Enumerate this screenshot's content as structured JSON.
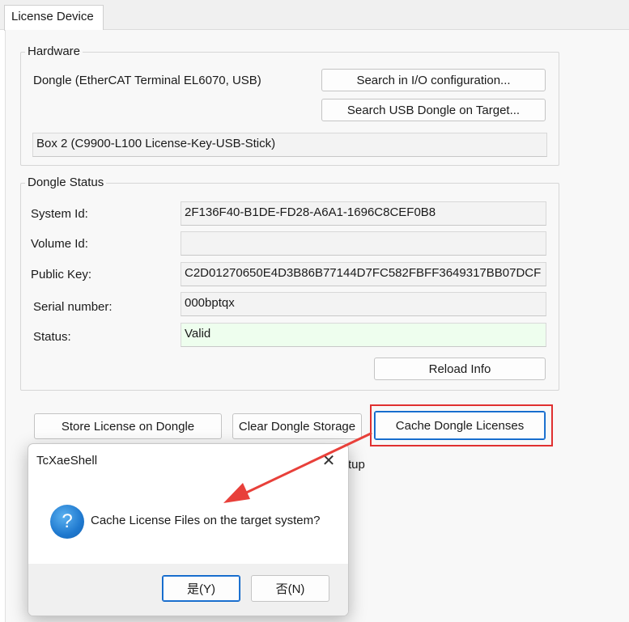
{
  "tab": {
    "label": "License Device"
  },
  "hardware": {
    "legend": "Hardware",
    "dongle_label": "Dongle (EtherCAT Terminal EL6070, USB)",
    "search_io_button": "Search in I/O configuration...",
    "search_usb_button": "Search USB Dongle on Target...",
    "box_value": "Box 2 (C9900-L100 License-Key-USB-Stick)"
  },
  "status": {
    "legend": "Dongle Status",
    "rows": [
      {
        "label": "System Id:",
        "value": "2F136F40-B1DE-FD28-A6A1-1696C8CEF0B8"
      },
      {
        "label": "Volume Id:",
        "value": ""
      },
      {
        "label": "Public Key:",
        "value": "C2D01270650E4D3B86B77144D7FC582FBFF3649317BB07DCF"
      },
      {
        "label": "Serial number:",
        "value": "000bptqx"
      },
      {
        "label": "Status:",
        "value": "Valid"
      }
    ],
    "reload_button": "Reload Info"
  },
  "actions": {
    "store_button": "Store License on Dongle",
    "clear_button": "Clear Dongle Storage",
    "cache_button": "Cache Dongle Licenses",
    "partial_text": "tup"
  },
  "dialog": {
    "title": "TcXaeShell",
    "close_glyph": "✕",
    "icon_glyph": "?",
    "message": "Cache License Files on the target system?",
    "yes_button": "是(Y)",
    "no_button": "否(N)"
  },
  "colors": {
    "highlight": "#e03030",
    "annotation_arrow": "#e8403a",
    "valid_bg": "#eefeee",
    "focus_border": "#0a64c8"
  }
}
